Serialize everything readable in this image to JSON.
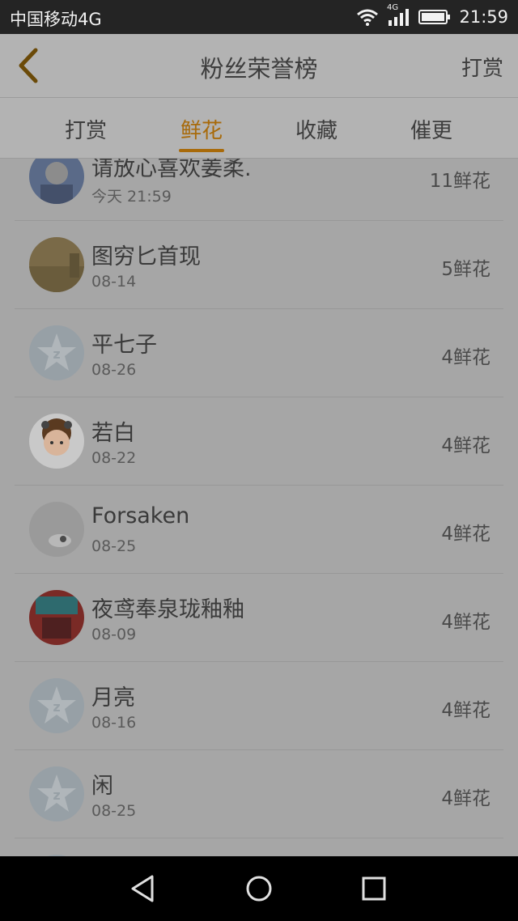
{
  "status_bar": {
    "carrier": "中国移动4G",
    "network": "4G",
    "time": "21:59"
  },
  "header": {
    "title": "粉丝荣誉榜",
    "action_label": "打赏"
  },
  "tabs": [
    {
      "label": "打赏",
      "active": false
    },
    {
      "label": "鲜花",
      "active": true
    },
    {
      "label": "收藏",
      "active": false
    },
    {
      "label": "催更",
      "active": false
    }
  ],
  "fans": [
    {
      "name": "请放心喜欢姜柔.",
      "date": "今天 21:59",
      "count": "11鲜花",
      "avatar": "photo-blue"
    },
    {
      "name": "图穷匕首现",
      "date": "08-14",
      "count": "5鲜花",
      "avatar": "photo-tan"
    },
    {
      "name": "平七子",
      "date": "08-26",
      "count": "4鲜花",
      "avatar": "default-star"
    },
    {
      "name": "若白",
      "date": "08-22",
      "count": "4鲜花",
      "avatar": "cartoon"
    },
    {
      "name": "Forsaken",
      "date": "08-25",
      "count": "4鲜花",
      "avatar": "photo-gray"
    },
    {
      "name": "夜鸢奉泉珑釉釉",
      "date": "08-09",
      "count": "4鲜花",
      "avatar": "photo-red"
    },
    {
      "name": "月亮",
      "date": "08-16",
      "count": "4鲜花",
      "avatar": "default-star"
    },
    {
      "name": "闲",
      "date": "08-25",
      "count": "4鲜花",
      "avatar": "default-star"
    },
    {
      "name": "",
      "date": "",
      "count": "",
      "avatar": "default-star"
    }
  ],
  "colors": {
    "accent": "#a86a0a",
    "overlay_bg": "#a6a6a6"
  }
}
